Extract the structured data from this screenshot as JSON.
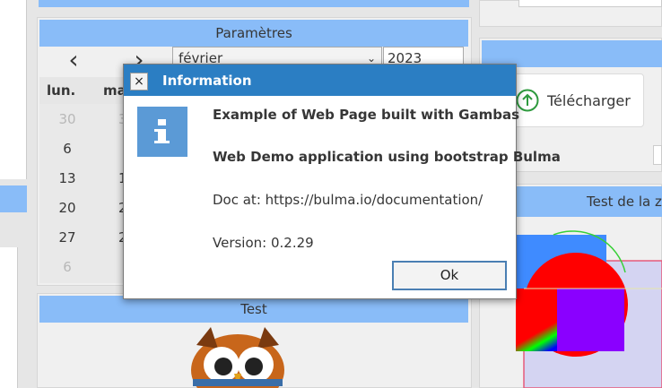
{
  "params": {
    "title": "Paramètres",
    "prev": "‹",
    "next": "›",
    "month": "février",
    "year": "2023",
    "col_headers": [
      "lun.",
      "ma"
    ],
    "days": [
      "30",
      "6",
      "13",
      "20",
      "27",
      "6"
    ],
    "days_col2": [
      "3",
      "1",
      "2",
      "2"
    ]
  },
  "test": {
    "title": "Test"
  },
  "download": {
    "label": "Télécharger"
  },
  "right_panel": {
    "title": "Test de la zo"
  },
  "dialog": {
    "title": "Information",
    "close": "×",
    "line1": "Example of Web Page built with Gambas",
    "line2": "Web Demo application using bootstrap Bulma",
    "line3": "Doc at: https://bulma.io/documentation/",
    "line4": "Version: 0.2.29",
    "ok_label": "Ok"
  },
  "colors": {
    "accent": "#89bcf8",
    "dialog_title_bg": "#2b7ec3",
    "info_icon_bg": "#5b9ad6",
    "download_icon": "#2e9a3e"
  }
}
